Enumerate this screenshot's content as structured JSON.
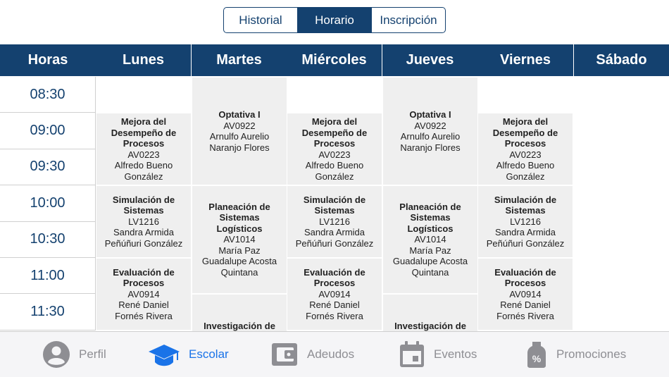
{
  "tabs_top": [
    {
      "label": "Historial",
      "active": false
    },
    {
      "label": "Horario",
      "active": true
    },
    {
      "label": "Inscripción",
      "active": false
    }
  ],
  "header": {
    "hours": "Horas",
    "days": [
      "Lunes",
      "Martes",
      "Miércoles",
      "Jueves",
      "Viernes",
      "Sábado"
    ]
  },
  "times": [
    "08:30",
    "09:00",
    "09:30",
    "10:00",
    "10:30",
    "11:00",
    "11:30"
  ],
  "classes": {
    "mejora": {
      "title": "Mejora del Desempeño de Procesos",
      "code": "AV0223",
      "teacher": "Alfredo Bueno González"
    },
    "optativa": {
      "title": "Optativa I",
      "code": "AV0922",
      "teacher": "Arnulfo Aurelio Naranjo Flores"
    },
    "simulacion": {
      "title": "Simulación de Sistemas",
      "code": "LV1216",
      "teacher": "Sandra Armida Peñúñuri González"
    },
    "planeacion": {
      "title": "Planeación de Sistemas Logísticos",
      "code": "AV1014",
      "teacher": "María Paz Guadalupe Acosta Quintana"
    },
    "evaluacion": {
      "title": "Evaluación de Procesos",
      "code": "AV0914",
      "teacher": "René Daniel Fornés Rivera"
    },
    "investigacion": {
      "title": "Investigación de"
    }
  },
  "tabbar": [
    {
      "label": "Perfil",
      "icon": "person-icon",
      "active": false
    },
    {
      "label": "Escolar",
      "icon": "graduation-cap-icon",
      "active": true
    },
    {
      "label": "Adeudos",
      "icon": "wallet-icon",
      "active": false
    },
    {
      "label": "Eventos",
      "icon": "calendar-icon",
      "active": false
    },
    {
      "label": "Promociones",
      "icon": "promo-tag-icon",
      "active": false
    }
  ],
  "colors": {
    "primary": "#14416f",
    "active_tab": "#1a73e8",
    "block_bg": "#efefef"
  }
}
